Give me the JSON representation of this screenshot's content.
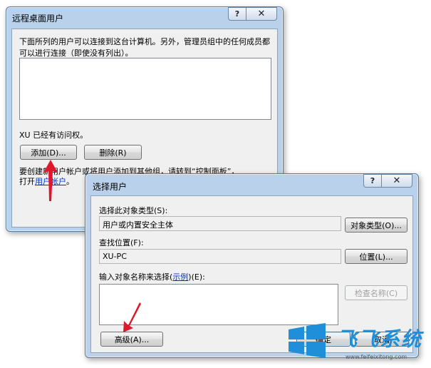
{
  "dialog_rdp": {
    "title": "远程桌面用户",
    "help": "?",
    "close": "✕",
    "description": "下面所列的用户可以连接到这台计算机。另外，管理员组中的任何成员都可以进行连接（即使没有列出）。",
    "access_note": "XU 已经有访问权。",
    "add_button": "添加(D)...",
    "remove_button": "删除(R)",
    "footer_text_1": "要创建新用户帐户或将用户添加到其他组，请转到“控制面板”，",
    "footer_text_2_prefix": "打开",
    "footer_link": "用户帐户",
    "footer_text_2_suffix": "。"
  },
  "dialog_select": {
    "title": "选择用户",
    "help": "?",
    "close": "✕",
    "object_type_label": "选择此对象类型(S):",
    "object_type_value": "用户或内置安全主体",
    "object_type_button": "对象类型(O)...",
    "location_label": "查找位置(F):",
    "location_value": "XU-PC",
    "location_button": "位置(L)...",
    "names_label_prefix": "输入对象名称来选择(",
    "names_label_link": "示例",
    "names_label_suffix": ")(E):",
    "check_names_button": "检查名称(C)",
    "advanced_button": "高级(A)...",
    "ok_button": "确定",
    "cancel_button": "取消"
  },
  "watermark": {
    "brand_text": "飞飞系统",
    "url_text": "www.feifeixitong.com",
    "brand_color": "#1e8fd8"
  },
  "colors": {
    "annotation_arrow": "#e0162b",
    "frame": "#b9d1ea",
    "client": "#f0f0f0"
  }
}
